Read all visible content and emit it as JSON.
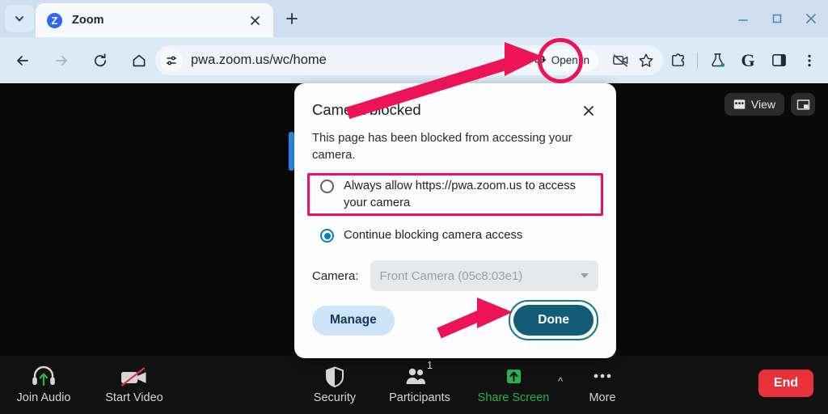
{
  "browser": {
    "tab": {
      "title": "Zoom",
      "favicon_letter": "Z"
    },
    "url": "pwa.zoom.us/wc/home",
    "open_in_chip": "Open in",
    "icons": {
      "tab_search": "chevron-down-icon",
      "tab_close": "close-icon",
      "new_tab": "plus-icon",
      "back": "back-arrow-icon",
      "forward": "forward-arrow-icon",
      "reload": "reload-icon",
      "home": "home-icon",
      "site_settings": "tune-icon",
      "camera_blocked": "camera-blocked-icon",
      "bookmark": "star-icon",
      "extensions": "extensions-icon",
      "labs": "flask-icon",
      "google": "G",
      "side_panel": "side-panel-icon",
      "menu": "three-dot-menu-icon",
      "minimize": "minimize-icon",
      "maximize": "maximize-icon",
      "close_window": "close-window-icon"
    }
  },
  "dialog": {
    "title": "Camera blocked",
    "description": "This page has been blocked from accessing your camera.",
    "options": [
      {
        "label": "Always allow https://pwa.zoom.us to access your camera",
        "selected": false,
        "highlighted": true
      },
      {
        "label": "Continue blocking camera access",
        "selected": true,
        "highlighted": false
      }
    ],
    "camera_label": "Camera:",
    "camera_value": "Front Camera (05c8:03e1)",
    "camera_disabled": true,
    "manage_label": "Manage",
    "done_label": "Done",
    "close_icon": "close-icon"
  },
  "zoom_app": {
    "view_button": "View",
    "view_icon": "grid-view-icon",
    "pip_icon": "picture-in-picture-icon",
    "toolbar": [
      {
        "label": "Join Audio",
        "icon": "headset-join-audio-icon",
        "state": "off"
      },
      {
        "label": "Start Video",
        "icon": "camera-off-icon",
        "state": "off"
      },
      {
        "label": "Security",
        "icon": "shield-icon",
        "state": "normal"
      },
      {
        "label": "Participants",
        "icon": "participants-icon",
        "badge": "1",
        "state": "normal"
      },
      {
        "label": "Share Screen",
        "icon": "share-screen-icon",
        "state": "active"
      },
      {
        "label": "More",
        "icon": "ellipsis-icon",
        "state": "normal"
      }
    ],
    "end_label": "End"
  },
  "colors": {
    "annotation_pink": "#ec1457",
    "chrome_tabstrip": "#cfdff0",
    "chrome_toolbar": "#dce9f7",
    "zoom_green": "#28b14c",
    "end_red": "#e8313a",
    "done_teal": "#125c78",
    "radio_blue": "#0b7dc4"
  }
}
